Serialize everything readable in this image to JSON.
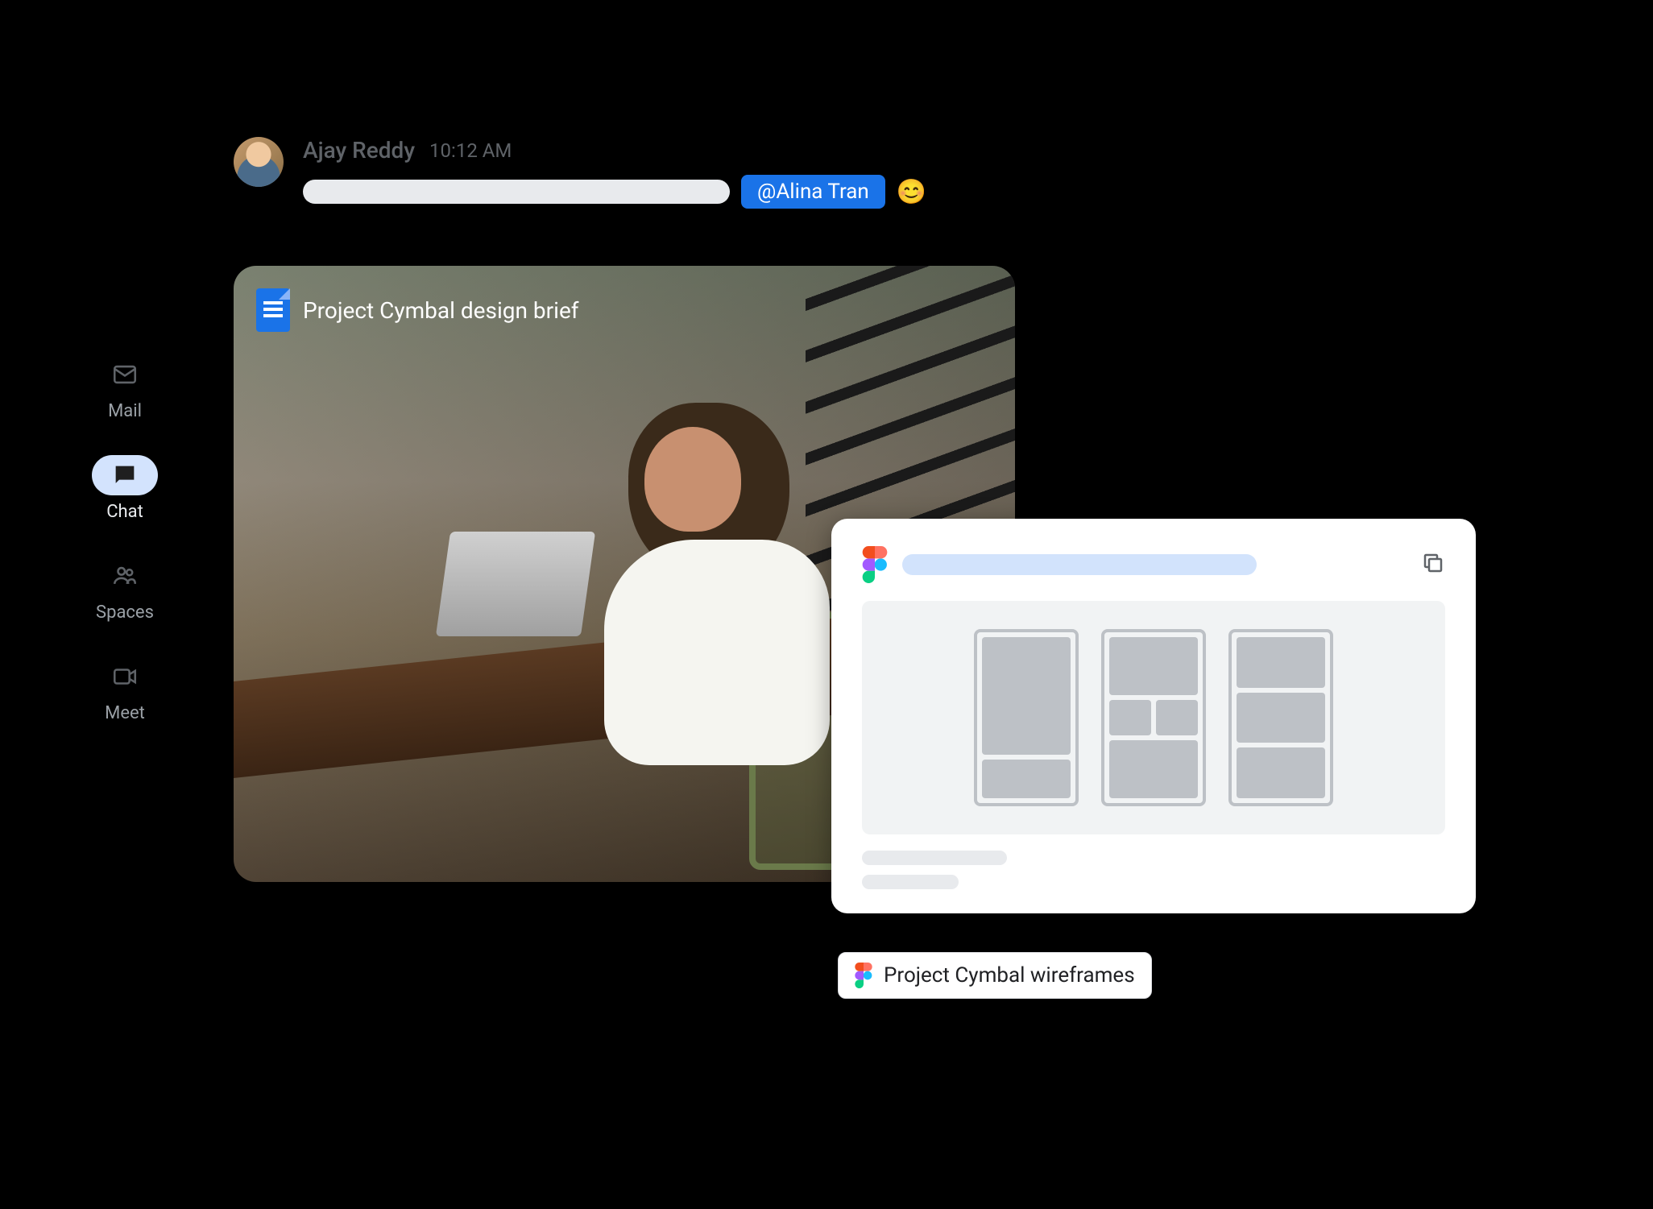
{
  "sidebar": {
    "items": [
      {
        "label": "Mail"
      },
      {
        "label": "Chat"
      },
      {
        "label": "Spaces"
      },
      {
        "label": "Meet"
      }
    ],
    "active_index": 1
  },
  "message": {
    "author": "Ajay Reddy",
    "timestamp": "10:12 AM",
    "mention": "@Alina Tran",
    "emoji": "😊"
  },
  "attachment_doc": {
    "title": "Project Cymbal design brief",
    "app": "Google Docs"
  },
  "figma_card": {
    "chip_label": "Project Cymbal wireframes",
    "app": "Figma"
  }
}
